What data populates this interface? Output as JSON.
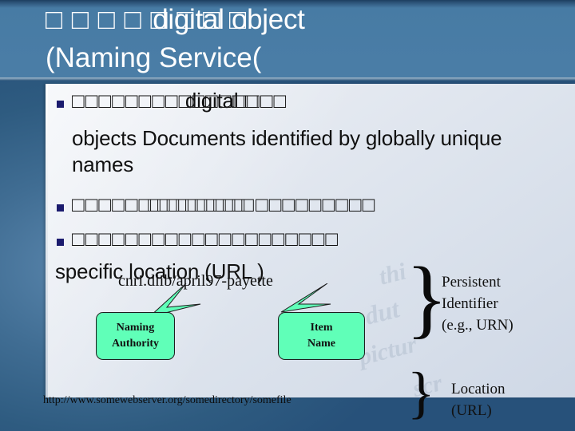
{
  "slide": {
    "title_line1_boxes": "□ □ □ □ □ □ □ □",
    "title_line1_latin": "digital object",
    "title_line2": "(Naming Service(",
    "colors": {
      "title_band": "#4a7da6",
      "panel": "#e3e8f0",
      "bullet_mark": "#1b1b6e",
      "callout_fill": "#60ffb8",
      "text": "#111111",
      "title_text": "#ffffff"
    }
  },
  "bullets": [
    {
      "marker": "■",
      "boxes": "□□□□□□□□□□□□□□",
      "latin_inline": "digital",
      "boxes_tail": "□□□□",
      "continuation": "objects Documents identified by globally unique names"
    },
    {
      "marker": "■",
      "boxes_left": "□□□□□",
      "boxes_narrow": "□□□□□□□□□□□□",
      "boxes_right": "□□□□□□□□□",
      "continuation": ""
    },
    {
      "marker": "■",
      "boxes": "□□□□□□□□□□□□□□□□□□□□",
      "continuation": "specific location (URL )"
    }
  ],
  "diagram": {
    "handle_string": "cnri.dlib/april97-payette",
    "callouts": [
      {
        "line1": "Naming",
        "line2": "Authority"
      },
      {
        "line1": "Item",
        "line2": "Name"
      }
    ],
    "brace_glyph": "}",
    "labels": {
      "persistent_line1": "Persistent",
      "persistent_line2": "Identifier",
      "persistent_line3": "(e.g., URN)",
      "location_line1": "Location",
      "location_line2": "(URL)"
    },
    "bottom_url": "http://www.somewebserver.org/somedirectory/somefile",
    "watermarks": [
      "thi",
      "dut",
      "pictur",
      "scr"
    ]
  }
}
